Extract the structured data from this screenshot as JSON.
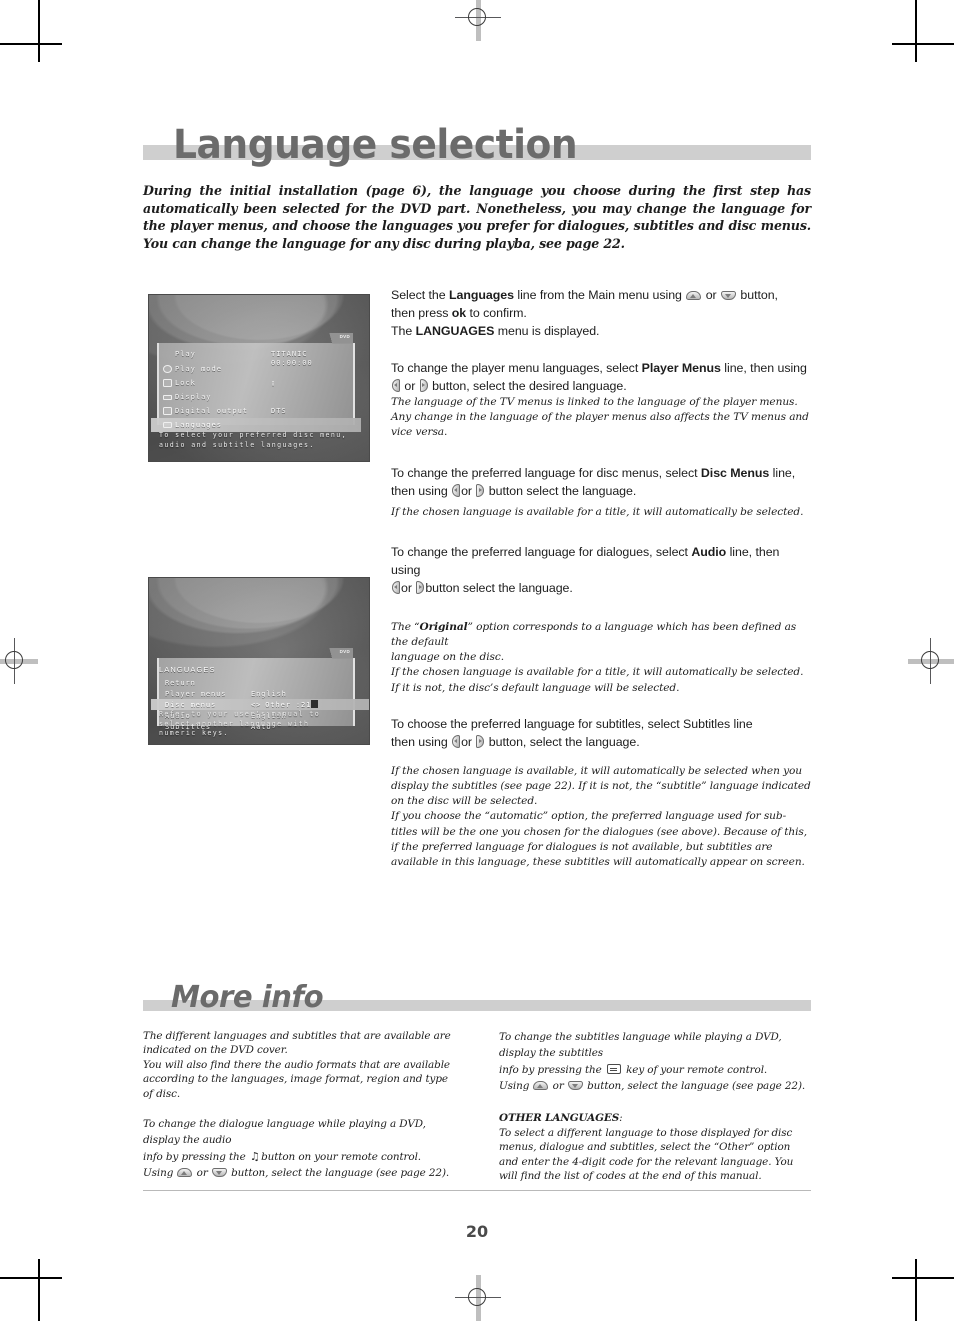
{
  "page": {
    "folio": "20",
    "heading": "Language selection",
    "intro": "During the initial installation (page 6), the language you choose during the first step has automatically been selected for the DVD part. Nonetheless, you may change the language for the player menus, and choose the languages you prefer for dialogues, subtitles and disc menus. You can change the language for any disc during playba, see page 22."
  },
  "screenshot_main_menu": {
    "dvd_tag": "DVD",
    "rows": [
      {
        "icon": "none",
        "label": "Play",
        "value": "TITANIC",
        "value2": "00:00:00",
        "selected": false
      },
      {
        "icon": "play-mode-icon",
        "label": "Play mode",
        "value": "",
        "selected": false
      },
      {
        "icon": "lock-icon",
        "label": "Lock",
        "value": "lock-glyph",
        "selected": false
      },
      {
        "icon": "display-icon",
        "label": "Display",
        "value": "",
        "selected": false
      },
      {
        "icon": "digital-output-icon",
        "label": "Digital output",
        "value": "DTS",
        "selected": false
      },
      {
        "icon": "languages-icon",
        "label": "Languages",
        "value": "",
        "selected": true
      }
    ],
    "caption_line1": "To select your preferred disc menu,",
    "caption_line2": "audio and subtitle languages."
  },
  "screenshot_languages_menu": {
    "dvd_tag": "DVD",
    "title": "LANGUAGES",
    "rows": [
      {
        "label": "Return",
        "value": "",
        "selected": false,
        "arrows": false
      },
      {
        "label": "Player menus",
        "value": "English",
        "selected": false,
        "arrows": false
      },
      {
        "label": "Disc menus",
        "value": "Other :21",
        "selected": true,
        "arrows": true
      },
      {
        "label": "Audio",
        "value": "English",
        "selected": false,
        "arrows": false
      },
      {
        "label": "Subtitles",
        "value": "Auto",
        "selected": false,
        "arrows": false
      }
    ],
    "caption_line1": "Refer to your user's manual to",
    "caption_line2": "select another language with",
    "caption_line3": "numeric keys."
  },
  "instructions": {
    "p1_a": "Select the ",
    "p1_b": "Languages",
    "p1_c": " line from the Main menu using ",
    "p1_d": " or ",
    "p1_e": " button,",
    "p1_line2_a": "then press ",
    "p1_line2_b": "ok",
    "p1_line2_c": " to confirm.",
    "p1_line3_a": "The ",
    "p1_line3_b": "LANGUAGES",
    "p1_line3_c": " menu is displayed.",
    "p2_a": "To change the player menu languages, select ",
    "p2_b": "Player Menus",
    "p2_c": " line, then using",
    "p2_d": " or ",
    "p2_e": " button, select the desired language.",
    "p2_note1": "The language of the TV menus is linked to the language of the player menus.",
    "p2_note2": "Any change in the language of the player menus also affects the TV menus and vice versa.",
    "p3_a": "To change the preferred language for disc menus, select ",
    "p3_b": "Disc Menus",
    "p3_c": " line,",
    "p3_d": "then using ",
    "p3_e": "or ",
    "p3_f": " button select the language.",
    "p3_note": "If the chosen language is available for a title, it will automatically be selected.",
    "p4_a": "To change the preferred language for dialogues, select ",
    "p4_b": "Audio",
    "p4_c": " line, then using",
    "p4_d": "or ",
    "p4_e": "button select the language.",
    "p5_note1_a": "The “",
    "p5_note1_b": "Original",
    "p5_note1_c": "” option corresponds to a language which has been defined as the default",
    "p5_note1_d": "language on the disc.",
    "p5_note2": "If the chosen language is available for a title, it will automatically be selected.",
    "p5_note3": "If it is not, the disc’s default language will be selected.",
    "p6_a": "To choose the preferred language for subtitles, select Subtitles line",
    "p6_b": "then using ",
    "p6_c": "or ",
    "p6_d": " button, select the language.",
    "p6_note": "If the chosen language is available, it will automatically be selected when you display the subtitles (see page 22). If it is not, the “subtitle” language indicated on the disc will be selected.",
    "p6_note2": "If you choose the “automatic” option, the preferred language used for sub-titles will be the one you chosen for the dialogues (see above). Because of this, if the preferred language for dialogues is not available, but subtitles are available in this language, these subtitles will automatically appear on screen."
  },
  "more_info": {
    "heading": "More info",
    "left": {
      "p1_line1": "The different languages and subtitles that are available are",
      "p1_line2": "indicated on the DVD cover.",
      "p1_line3": "You will also find there the audio formats that are available",
      "p1_line4": "according to the languages, image format, region and type of disc.",
      "p2_a": "To change the dialogue language while playing a DVD, display the audio",
      "p2_b": "info by pressing the ",
      "p2_c": " button on your remote control.",
      "p2_d": "Using ",
      "p2_e": " or ",
      "p2_f": " button, select the language (see page 22)."
    },
    "right": {
      "p1_a": "To change the subtitles language while playing a DVD, display the subtitles",
      "p1_b": "info by pressing the ",
      "p1_c": " key of your remote control.",
      "p1_d": "Using ",
      "p1_e": " or ",
      "p1_f": " button, select the language (see page 22).",
      "p2_head": "OTHER LANGUAGES",
      "p2_colon": ":",
      "p2_body": "To select a different language to those displayed for disc menus, dialogue and subtitles, select the “Other” option and enter the 4-digit code for the relevant language. You will find the list of codes at the end of this manual."
    }
  },
  "colors": {
    "band": "#cfcfcf",
    "heading_text": "#6b6b6b",
    "body_text": "#1d1d1d",
    "folio": "#4a4a4a"
  }
}
